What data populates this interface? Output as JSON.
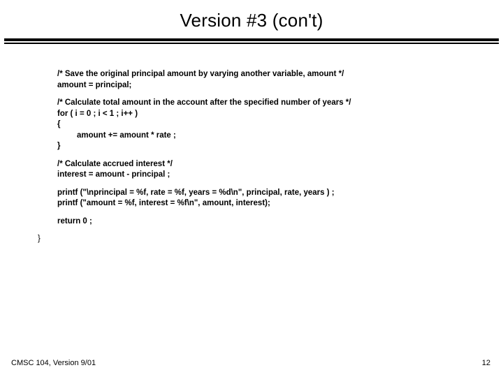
{
  "title": "Version #3 (con't)",
  "code": {
    "c1_line1": "/* Save the original principal amount by varying another variable, amount */",
    "c1_line2": "amount = principal;",
    "c2_line1": "/* Calculate total amount in the account after the specified number of years */",
    "c2_line2": "for  ( i = 0 ;  i < 1 ;  i++ )",
    "c2_line3": "{",
    "c2_line4": "amount  +=   amount  * rate ;",
    "c2_line5": "}",
    "c3_line1": "/* Calculate accrued interest */",
    "c3_line2": "interest  =  amount  - principal ;",
    "c4_line1": "printf (\"\\nprincipal = %f,  rate = %f, years = %d\\n\",  principal, rate, years ) ;",
    "c4_line2": "printf (\"amount = %f,  interest = %f\\n\", amount, interest);",
    "c5_line1": "return 0 ;",
    "c6_line1": "}"
  },
  "footer": {
    "left": "CMSC 104, Version 9/01",
    "right": "12"
  }
}
